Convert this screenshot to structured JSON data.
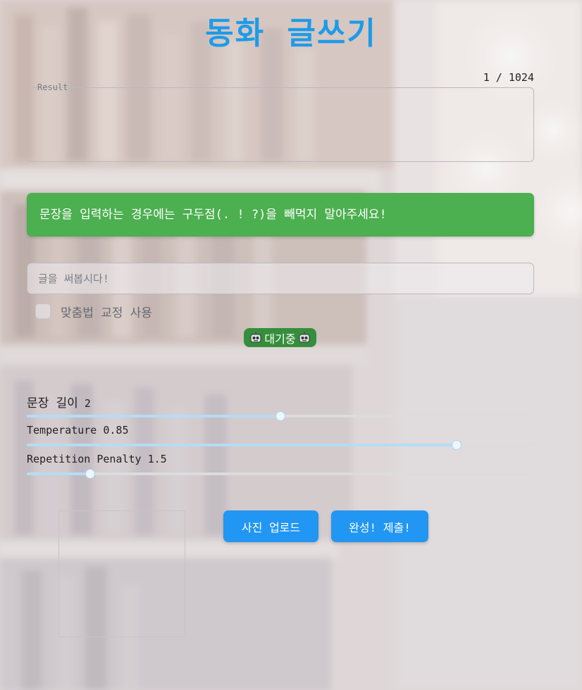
{
  "app": {
    "title": "동화 글쓰기",
    "counter": "1 / 1024"
  },
  "result": {
    "label": "Result",
    "value": ""
  },
  "notice": {
    "text": "문장을 입력하는 경우에는 구두점(. ! ?)을 빼먹지 말아주세요!",
    "color": "#4caf50"
  },
  "input": {
    "placeholder": "글을 써봅시다!",
    "value": ""
  },
  "spellcheck": {
    "label": "맞춤법 교정 사용",
    "checked": false
  },
  "status": {
    "label": "대기중",
    "icon": "robot-icon",
    "color": "#358e3b"
  },
  "sliders": [
    {
      "label": "문장 길이",
      "value": "2",
      "fraction": 0.5
    },
    {
      "label": "Temperature",
      "value": "0.85",
      "fraction": 0.847
    },
    {
      "label": "Repetition Penalty",
      "value": "1.5",
      "fraction": 0.125
    }
  ],
  "buttons": {
    "upload": "사진 업로드",
    "submit": "완성! 제출!",
    "color": "#2196f3"
  },
  "theme": {
    "accent": "#1e9be8",
    "slider_fill": "#b5dcf5"
  }
}
